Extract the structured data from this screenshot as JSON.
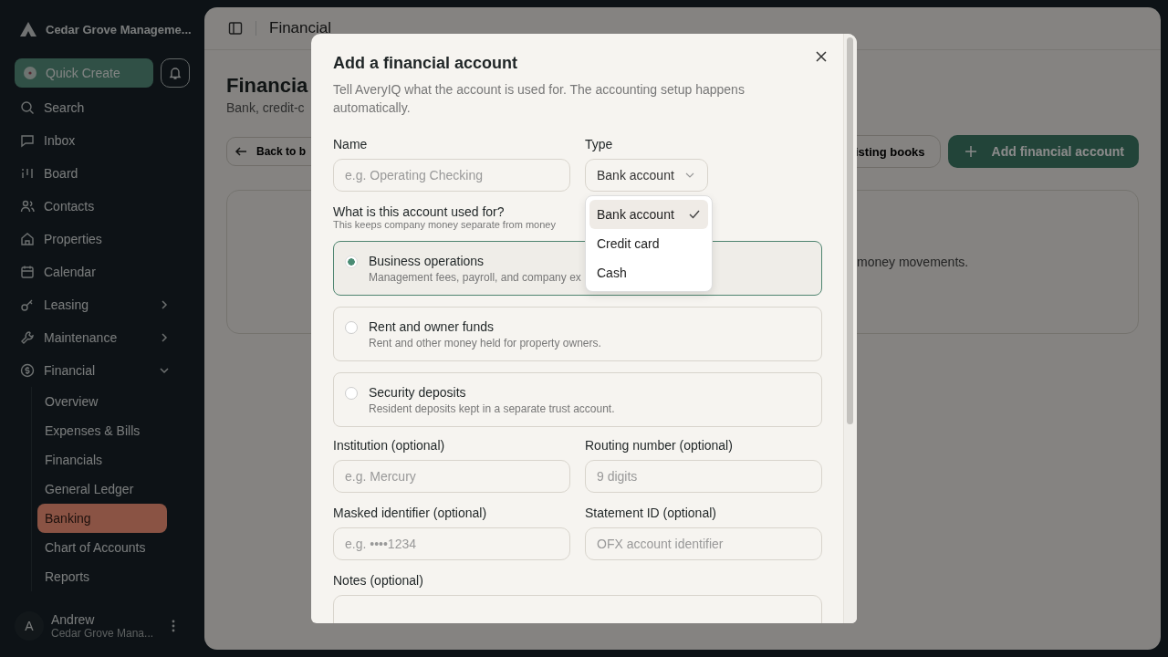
{
  "sidebar": {
    "org": "Cedar Grove Manageme...",
    "quick_create": "Quick Create",
    "nav": [
      {
        "label": "Search",
        "kind": "link"
      },
      {
        "label": "Inbox",
        "kind": "link"
      },
      {
        "label": "Board",
        "kind": "link"
      },
      {
        "label": "Contacts",
        "kind": "link"
      },
      {
        "label": "Properties",
        "kind": "link"
      },
      {
        "label": "Calendar",
        "kind": "link"
      },
      {
        "label": "Leasing",
        "kind": "group",
        "expanded": false
      },
      {
        "label": "Maintenance",
        "kind": "group",
        "expanded": false
      },
      {
        "label": "Financial",
        "kind": "group",
        "expanded": true,
        "children": [
          {
            "label": "Overview",
            "selected": false
          },
          {
            "label": "Expenses & Bills",
            "selected": false
          },
          {
            "label": "Financials",
            "selected": false
          },
          {
            "label": "General Ledger",
            "selected": false
          },
          {
            "label": "Banking",
            "selected": true
          },
          {
            "label": "Chart of Accounts",
            "selected": false
          },
          {
            "label": "Reports",
            "selected": false
          }
        ]
      }
    ],
    "user": {
      "initial": "A",
      "name": "Andrew",
      "org": "Cedar Grove Mana..."
    }
  },
  "header": {
    "title": "Financial"
  },
  "page": {
    "title": "Financia",
    "subtitle": "Bank, credit-c",
    "back_button": "Back to b",
    "books_button": "isting books",
    "add_button": "Add financial account",
    "card_text": "money movements."
  },
  "modal": {
    "title": "Add a financial account",
    "description": "Tell AveryIQ what the account is used for. The accounting setup happens automatically.",
    "name_field": {
      "label": "Name",
      "placeholder": "e.g. Operating Checking"
    },
    "type_field": {
      "label": "Type",
      "value": "Bank account",
      "expanded": true,
      "options": [
        {
          "label": "Bank account",
          "selected": true
        },
        {
          "label": "Credit card",
          "selected": false
        },
        {
          "label": "Cash",
          "selected": false
        }
      ]
    },
    "purpose": {
      "label": "What is this account used for?",
      "hint": "This keeps company money separate from money",
      "options": [
        {
          "title": "Business operations",
          "description": "Management fees, payroll, and company ex",
          "selected": true
        },
        {
          "title": "Rent and owner funds",
          "description": "Rent and other money held for property owners.",
          "selected": false
        },
        {
          "title": "Security deposits",
          "description": "Resident deposits kept in a separate trust account.",
          "selected": false
        }
      ]
    },
    "fields": [
      {
        "label": "Institution (optional)",
        "placeholder": "e.g. Mercury"
      },
      {
        "label": "Routing number (optional)",
        "placeholder": "9 digits"
      },
      {
        "label": "Masked identifier (optional)",
        "placeholder": "e.g. ••••1234"
      },
      {
        "label": "Statement ID (optional)",
        "placeholder": "OFX account identifier"
      }
    ],
    "notes": {
      "label": "Notes (optional)"
    }
  }
}
